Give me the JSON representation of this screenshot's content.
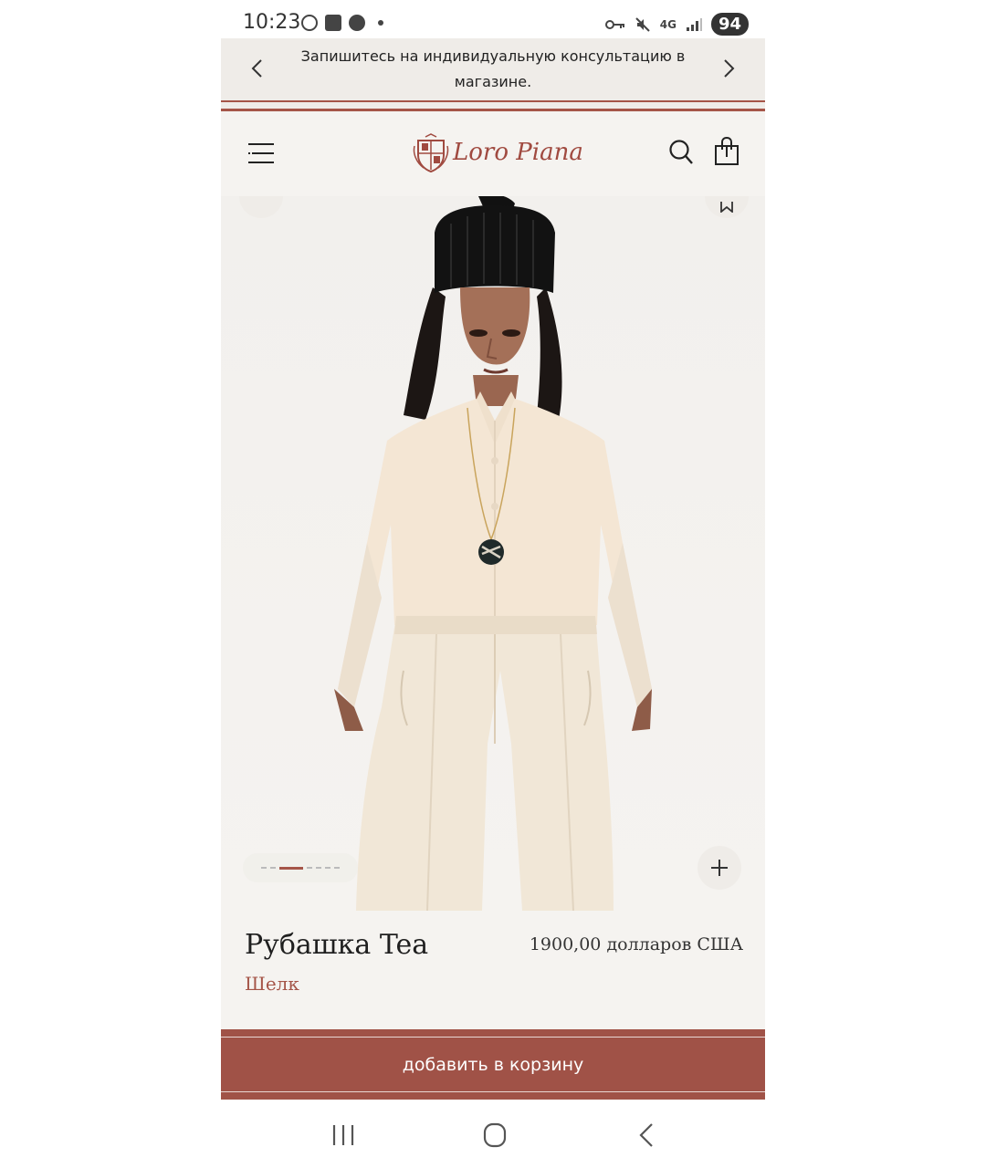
{
  "status_bar": {
    "time": "10:23",
    "network": "4G",
    "battery": "94"
  },
  "promo": {
    "text": "Запишитесь на индивидуальную консультацию в магазине."
  },
  "header": {
    "logo_text": "Loro Piana"
  },
  "product": {
    "title": "Рубашка Tea",
    "material": "Шелк",
    "price": "1900,00 долларов США",
    "image_count": 7,
    "current_image": 2
  },
  "actions": {
    "add_to_cart": "добавить в корзину"
  },
  "colors": {
    "brand": "#a05247",
    "background": "#f5f3f0",
    "promo_bg": "#efece8"
  }
}
